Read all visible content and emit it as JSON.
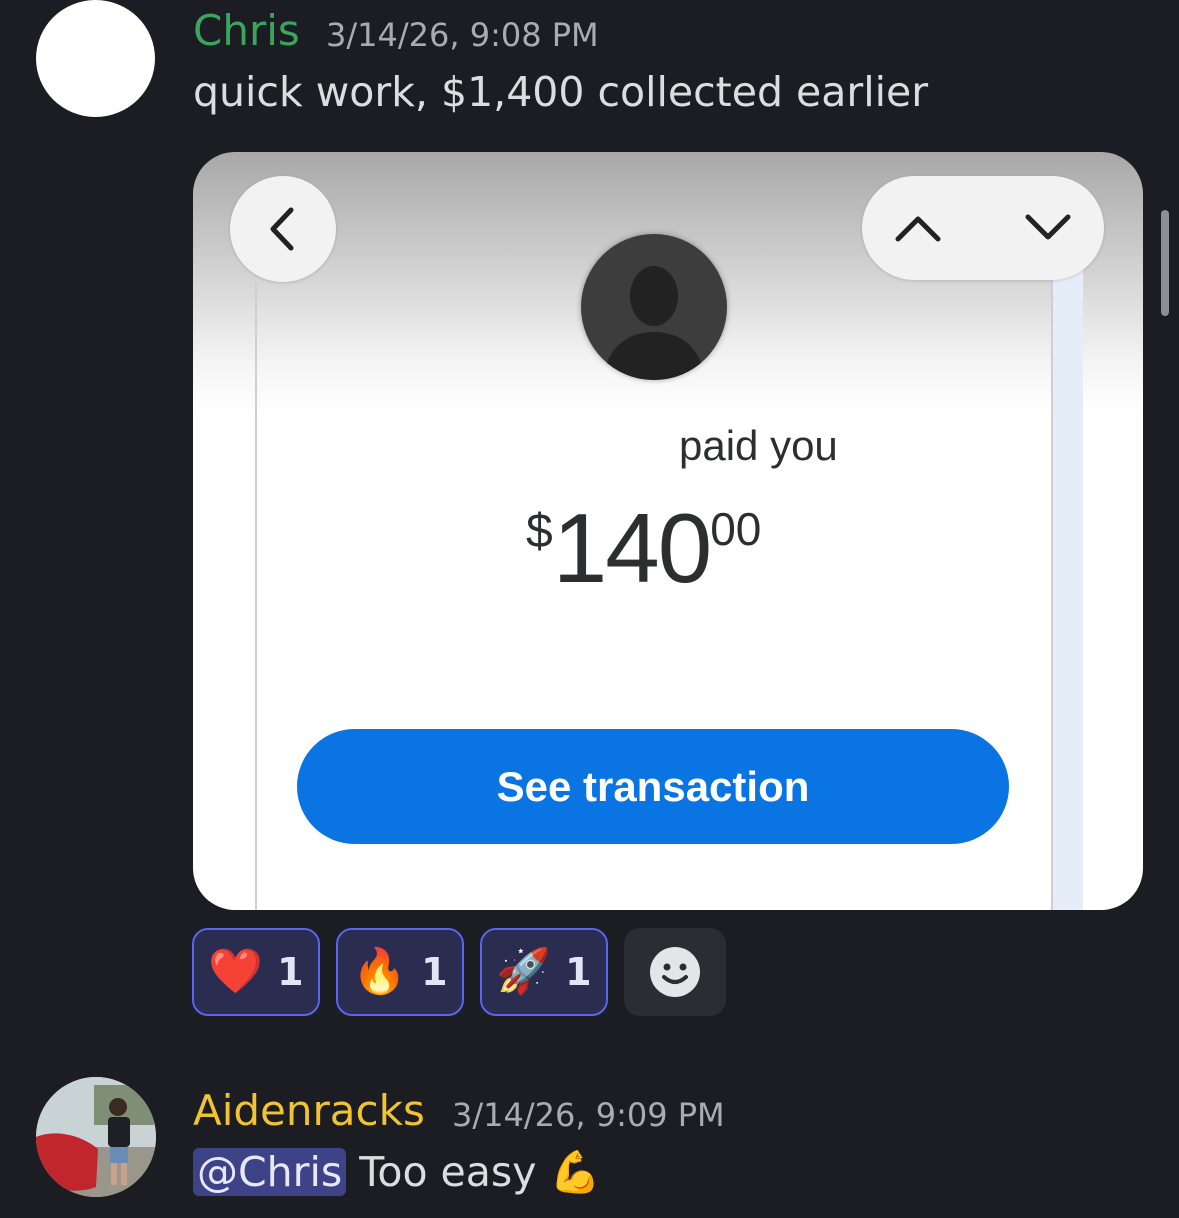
{
  "messages": [
    {
      "username": "Chris",
      "username_color": "#3ba55d",
      "timestamp": "3/14/26, 9:08 PM",
      "text": "quick work, $1,400 collected earlier",
      "attachment": {
        "status_text": "paid you",
        "amount_currency": "$",
        "amount_whole": "140",
        "amount_cents": "00",
        "button_label": "See transaction",
        "button_color": "#0a74e2"
      },
      "reactions": [
        {
          "emoji": "❤️",
          "icon": "heart-icon",
          "count": "1"
        },
        {
          "emoji": "🔥",
          "icon": "fire-icon",
          "count": "1"
        },
        {
          "emoji": "🚀",
          "icon": "rocket-icon",
          "count": "1"
        }
      ]
    },
    {
      "username": "Aidenracks",
      "username_color": "#f0c332",
      "timestamp": "3/14/26, 9:09 PM",
      "mention": "@Chris",
      "text": "Too easy",
      "emoji": "💪"
    }
  ],
  "colors": {
    "background": "#1c1d23",
    "reaction_border": "#5865f2",
    "reaction_bg": "#2a2d4f",
    "mention_bg": "#3d4386"
  }
}
